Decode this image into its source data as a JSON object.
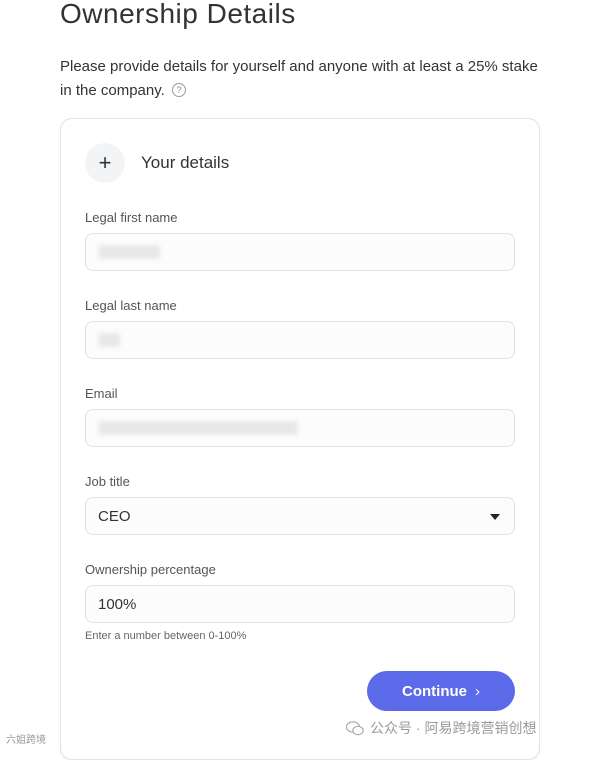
{
  "page": {
    "title": "Ownership Details",
    "intro": "Please provide details for yourself and anyone with at least a 25% stake in the company."
  },
  "section": {
    "icon": "plus-icon",
    "title": "Your details"
  },
  "fields": {
    "first_name": {
      "label": "Legal first name",
      "value": ""
    },
    "last_name": {
      "label": "Legal last name",
      "value": ""
    },
    "email": {
      "label": "Email",
      "value": ""
    },
    "job_title": {
      "label": "Job title",
      "value": "CEO"
    },
    "ownership": {
      "label": "Ownership percentage",
      "value": "100%",
      "hint": "Enter a number between 0-100%"
    }
  },
  "actions": {
    "continue_label": "Continue"
  },
  "watermarks": {
    "right": "公众号 · 阿易跨境营销创想",
    "left": "六姐跨境"
  }
}
